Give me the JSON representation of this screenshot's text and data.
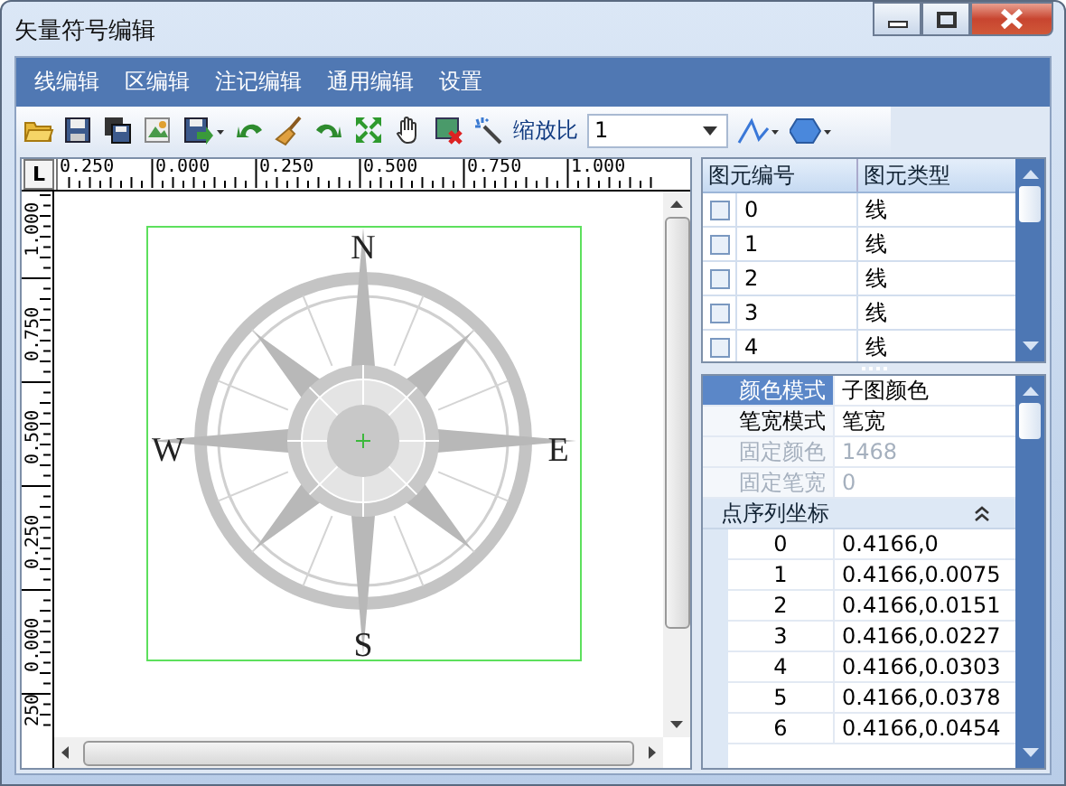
{
  "window": {
    "title": "矢量符号编辑"
  },
  "menu": [
    {
      "label": "线编辑"
    },
    {
      "label": "区编辑"
    },
    {
      "label": "注记编辑"
    },
    {
      "label": "通用编辑"
    },
    {
      "label": "设置"
    }
  ],
  "toolbar": {
    "zoom_label": "缩放比",
    "zoom_value": "1"
  },
  "ruler": {
    "corner": "L",
    "x_labels": [
      "0.250",
      "0.000",
      "0.250",
      "0.500",
      "0.750",
      "1.000"
    ],
    "y_labels": [
      "1.000",
      "0.750",
      "0.500",
      "0.250",
      "0.000",
      "250"
    ]
  },
  "canvas": {
    "labels": [
      {
        "kind": "n",
        "text": "N"
      },
      {
        "kind": "e",
        "text": "E"
      },
      {
        "kind": "s",
        "text": "S"
      },
      {
        "kind": "w",
        "text": "W"
      }
    ]
  },
  "elements": {
    "columns": [
      "图元编号",
      "图元类型"
    ],
    "rows": [
      {
        "id": "0",
        "type": "线",
        "checked": false
      },
      {
        "id": "1",
        "type": "线",
        "checked": false
      },
      {
        "id": "2",
        "type": "线",
        "checked": false
      },
      {
        "id": "3",
        "type": "线",
        "checked": false
      },
      {
        "id": "4",
        "type": "线",
        "checked": false
      }
    ]
  },
  "properties": [
    {
      "label": "颜色模式",
      "value": "子图颜色",
      "selected": true,
      "disabled": false
    },
    {
      "label": "笔宽模式",
      "value": "笔宽",
      "selected": false,
      "disabled": false
    },
    {
      "label": "固定颜色",
      "value": "1468",
      "selected": false,
      "disabled": true
    },
    {
      "label": "固定笔宽",
      "value": "0",
      "selected": false,
      "disabled": true
    }
  ],
  "point_group": {
    "title": "点序列坐标",
    "expanded": true,
    "points": [
      {
        "index": "0",
        "value": "0.4166,0"
      },
      {
        "index": "1",
        "value": "0.4166,0.0075"
      },
      {
        "index": "2",
        "value": "0.4166,0.0151"
      },
      {
        "index": "3",
        "value": "0.4166,0.0227"
      },
      {
        "index": "4",
        "value": "0.4166,0.0303"
      },
      {
        "index": "5",
        "value": "0.4166,0.0378"
      },
      {
        "index": "6",
        "value": "0.4166,0.0454"
      }
    ]
  }
}
